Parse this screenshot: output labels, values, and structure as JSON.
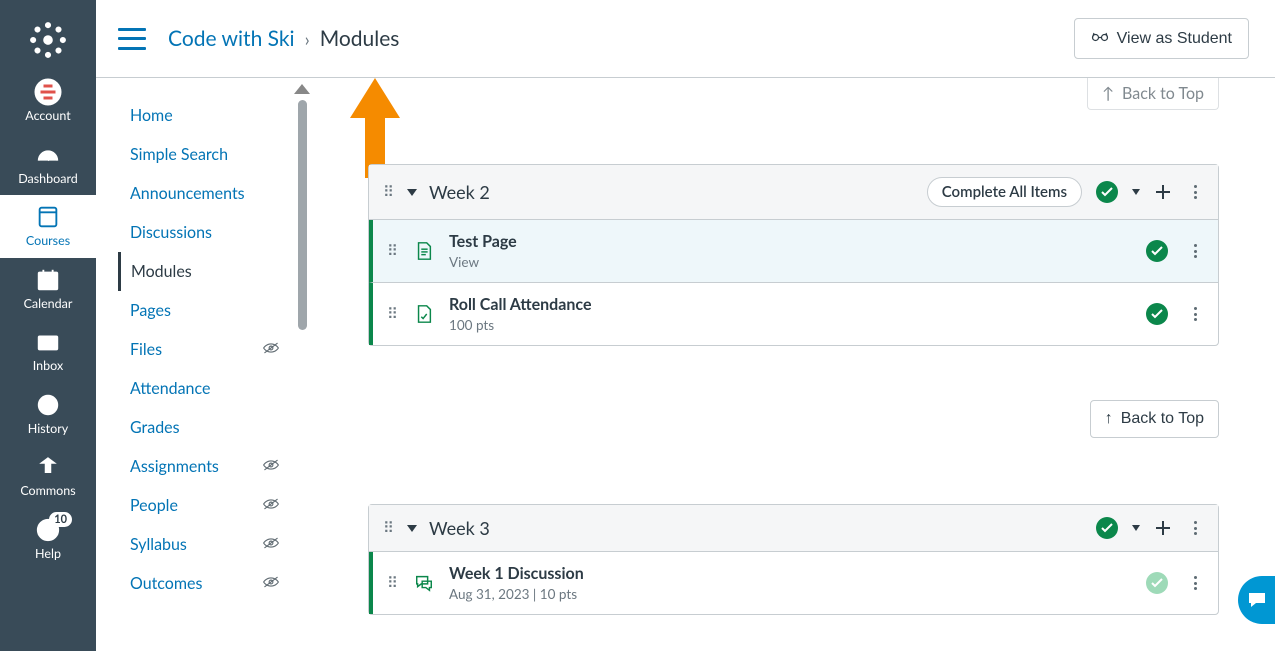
{
  "global_nav": {
    "items": [
      {
        "label": "Account"
      },
      {
        "label": "Dashboard"
      },
      {
        "label": "Courses"
      },
      {
        "label": "Calendar"
      },
      {
        "label": "Inbox"
      },
      {
        "label": "History"
      },
      {
        "label": "Commons"
      },
      {
        "label": "Help"
      }
    ],
    "help_badge": "10"
  },
  "breadcrumb": {
    "course": "Code with Ski",
    "page": "Modules"
  },
  "actions": {
    "view_as_student": "View as Student",
    "back_to_top": "Back to Top",
    "back_to_top_cut": "Back to Top"
  },
  "course_nav": {
    "items": [
      {
        "label": "Home",
        "hidden": false
      },
      {
        "label": "Simple Search",
        "hidden": false
      },
      {
        "label": "Announcements",
        "hidden": false
      },
      {
        "label": "Discussions",
        "hidden": false
      },
      {
        "label": "Modules",
        "hidden": false,
        "active": true
      },
      {
        "label": "Pages",
        "hidden": false
      },
      {
        "label": "Files",
        "hidden": true
      },
      {
        "label": "Attendance",
        "hidden": false
      },
      {
        "label": "Grades",
        "hidden": false
      },
      {
        "label": "Assignments",
        "hidden": true
      },
      {
        "label": "People",
        "hidden": true
      },
      {
        "label": "Syllabus",
        "hidden": true
      },
      {
        "label": "Outcomes",
        "hidden": true
      }
    ]
  },
  "modules": [
    {
      "title": "Week 2",
      "requirement": "Complete All Items",
      "items": [
        {
          "title": "Test Page",
          "meta": "View",
          "icon": "page",
          "highlight": true,
          "status": "done"
        },
        {
          "title": "Roll Call Attendance",
          "meta": "100 pts",
          "icon": "assignment",
          "status": "done"
        }
      ]
    },
    {
      "title": "Week 3",
      "requirement": null,
      "items": [
        {
          "title": "Week 1 Discussion",
          "meta": "Aug 31, 2023  |  10 pts",
          "icon": "discussion",
          "status": "muted"
        }
      ]
    }
  ]
}
